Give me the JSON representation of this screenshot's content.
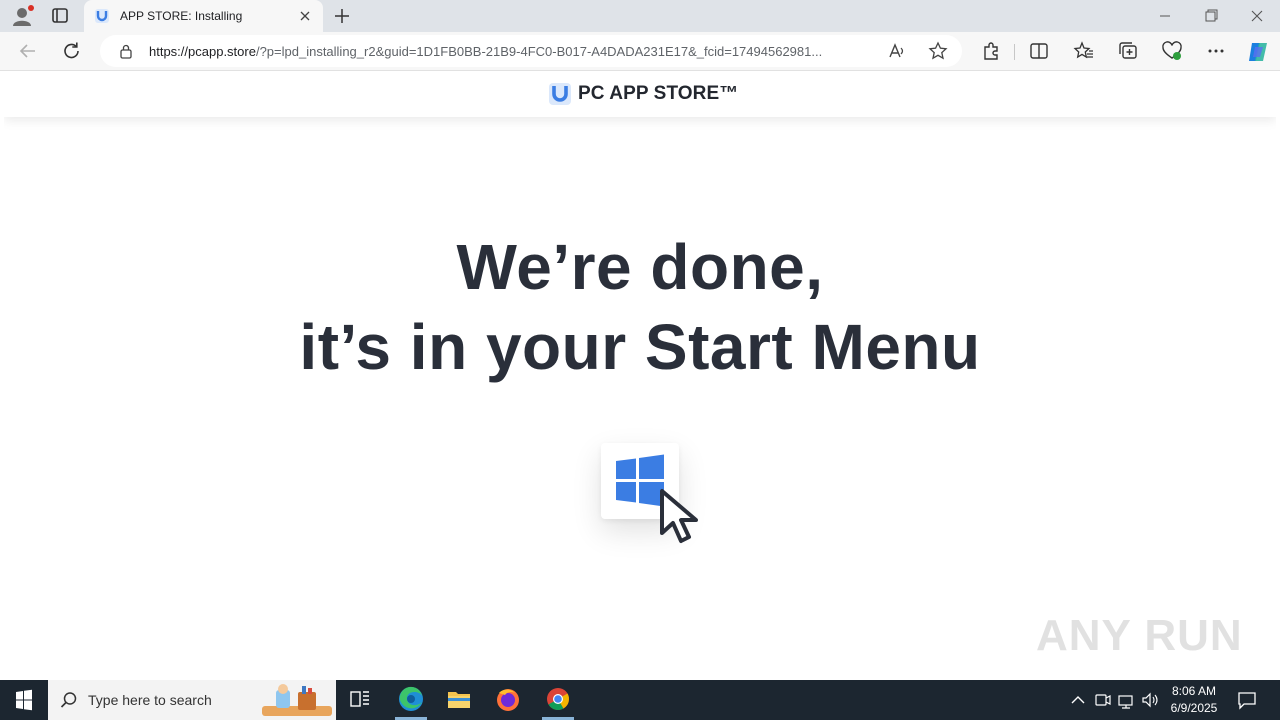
{
  "browser": {
    "tab": {
      "title": "APP STORE: Installing"
    },
    "url": {
      "host": "https://pcapp.store",
      "path": "/?p=lpd_installing_r2&guid=1D1FB0BB-21B9-4FC0-B017-A4DADA231E17&_fcid=17494562981..."
    }
  },
  "site": {
    "logo": "PC APP STORE™",
    "headline_line1": "We’re done,",
    "headline_line2": "it’s in your Start Menu",
    "accent_color": "#3b7de3"
  },
  "watermark": "ANY RUN",
  "taskbar": {
    "search_placeholder": "Type here to search",
    "time": "8:06 AM",
    "date": "6/9/2025"
  },
  "colors": {
    "headline": "#2a2f3a",
    "taskbar": "#1c2630",
    "tabstrip": "#dfe3e8"
  }
}
